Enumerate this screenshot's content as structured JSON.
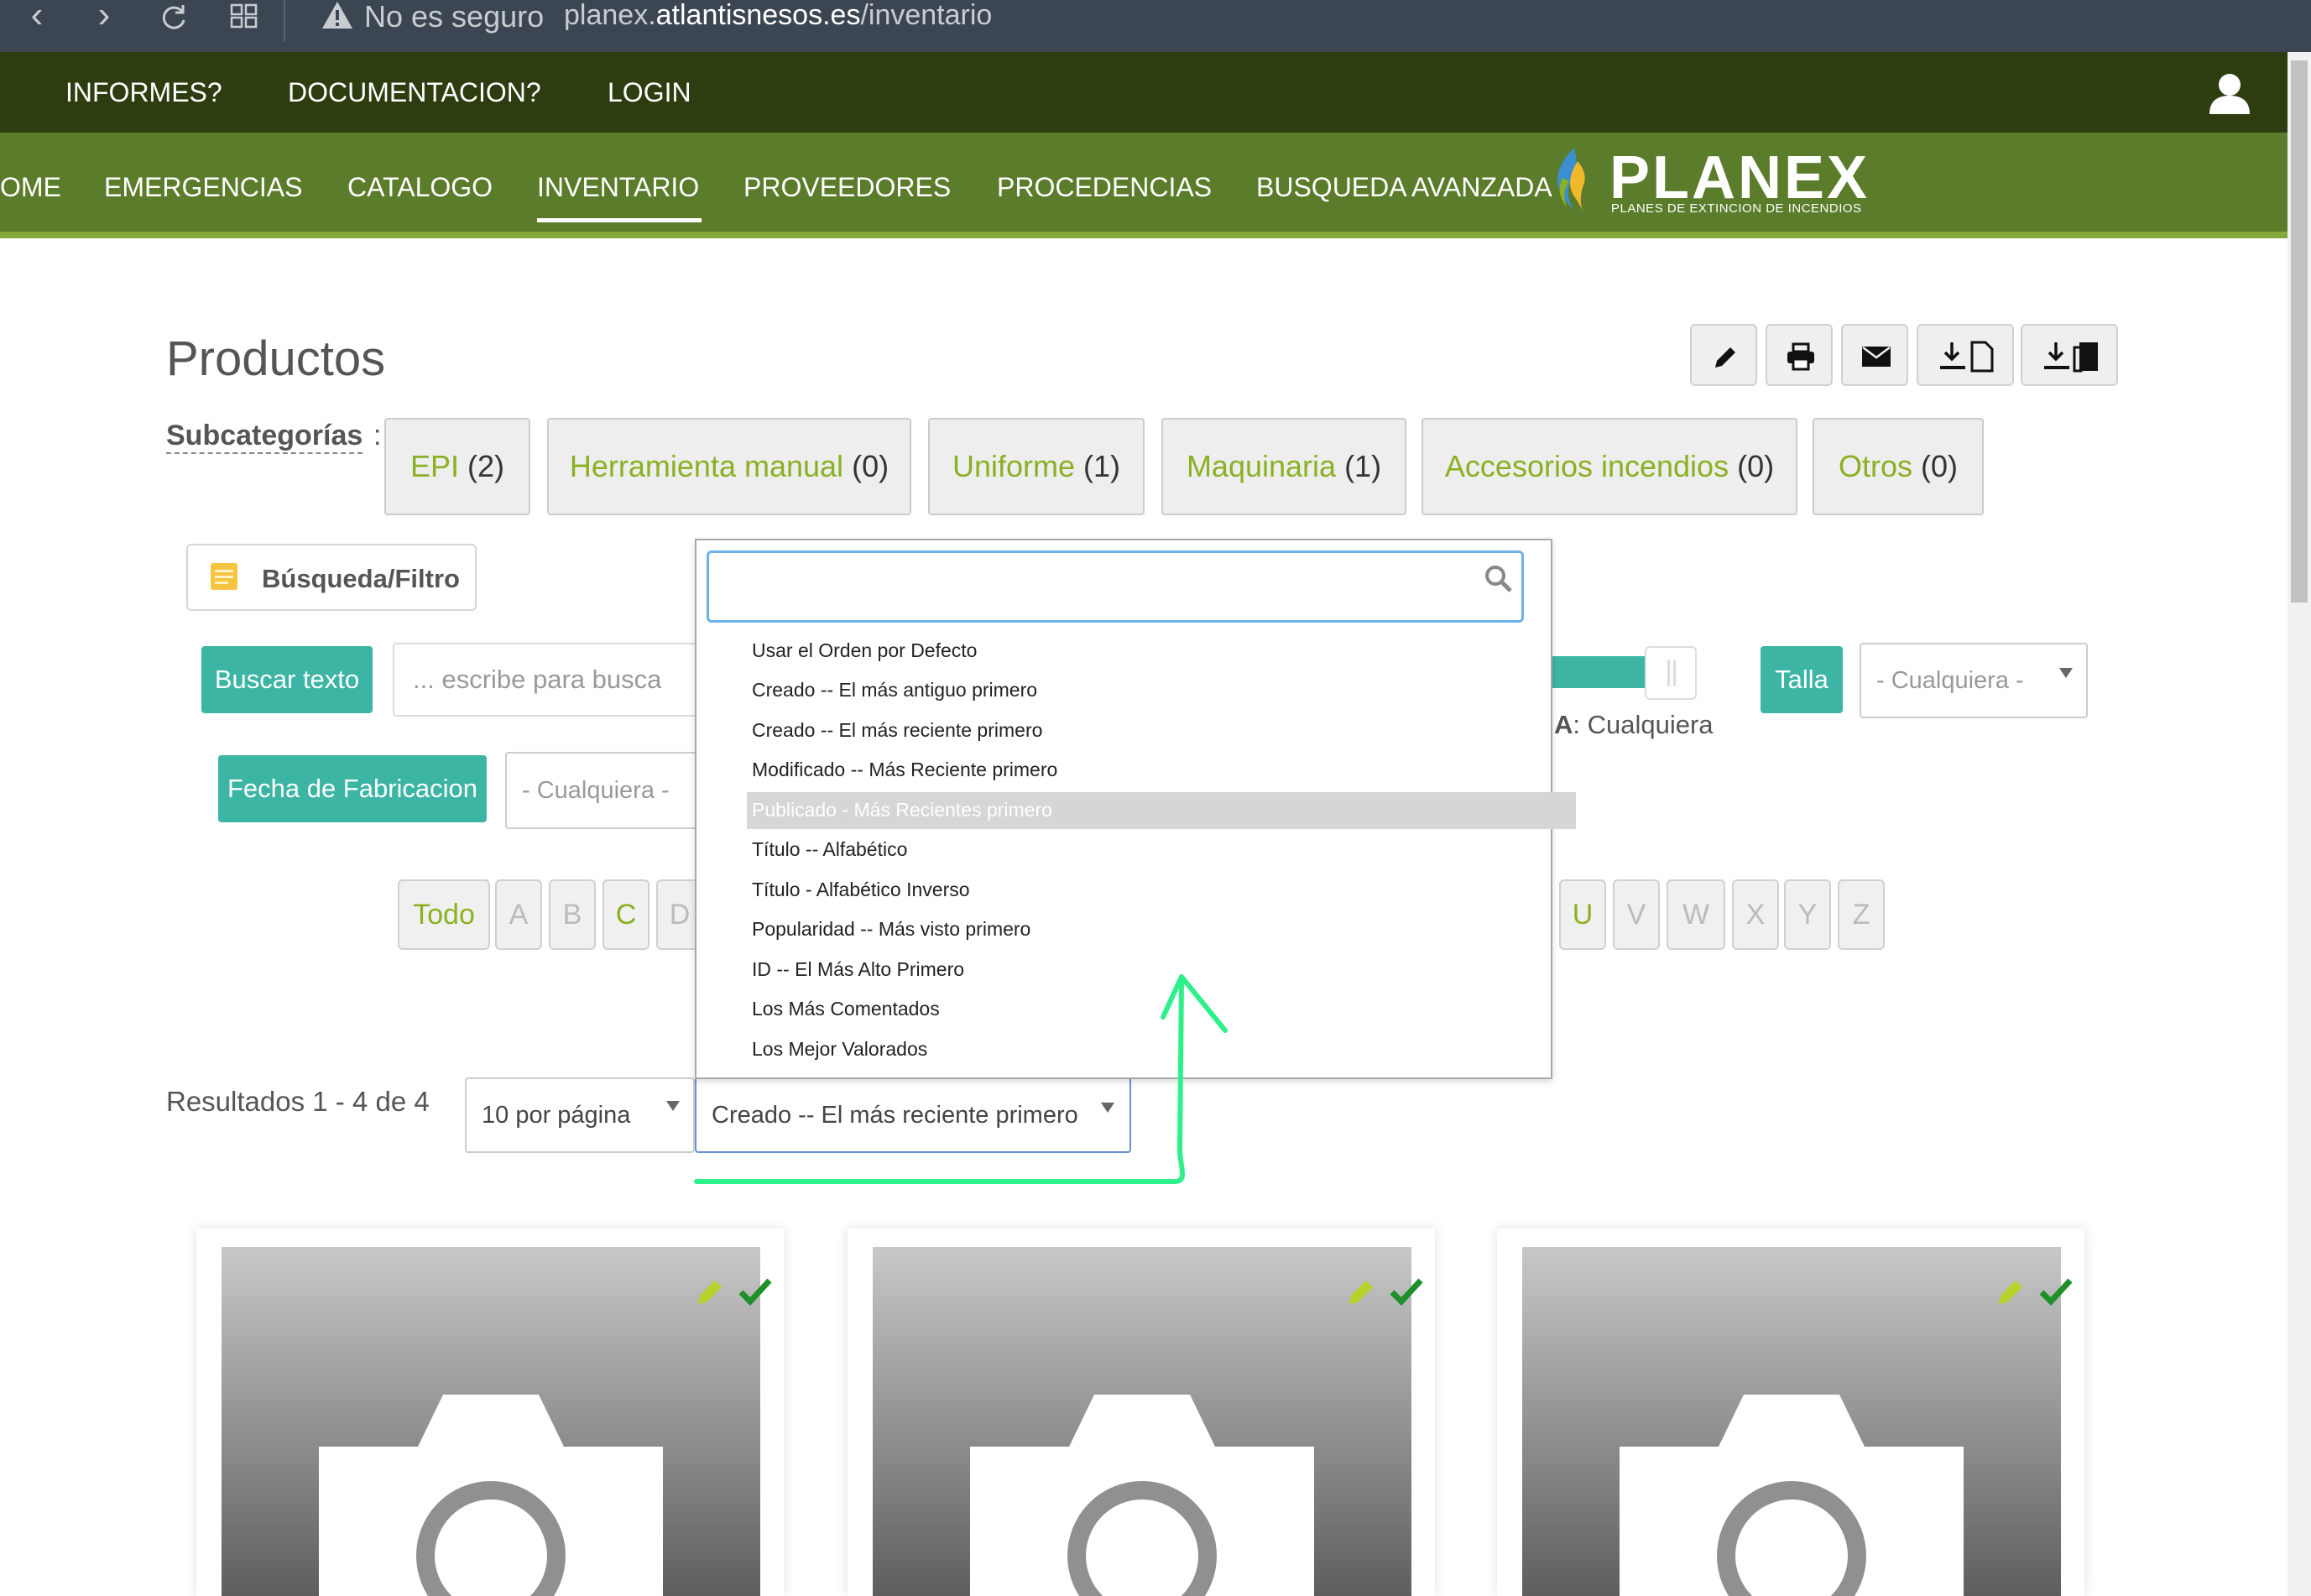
{
  "browser": {
    "warning_text": "No es seguro",
    "url_prefix": "planex.",
    "url_domain": "atlantisnesos.es",
    "url_path": "/inventario"
  },
  "top_nav": {
    "items": [
      "INFORMES?",
      "DOCUMENTACION?",
      "LOGIN"
    ]
  },
  "main_nav": {
    "items": [
      "OME",
      "EMERGENCIAS",
      "CATALOGO",
      "INVENTARIO",
      "PROVEEDORES",
      "PROCEDENCIAS",
      "BUSQUEDA AVANZADA"
    ],
    "active": "INVENTARIO"
  },
  "logo": {
    "name": "PLANEX",
    "subtitle": "PLANES DE EXTINCION DE INCENDIOS"
  },
  "page": {
    "title": "Productos"
  },
  "toolbar": {
    "icons": [
      "pencil-icon",
      "print-icon",
      "mail-icon",
      "download-doc-icon",
      "download-all-icon"
    ]
  },
  "subcategories": {
    "label": "Subcategorías",
    "colon": ":",
    "items": [
      {
        "name": "EPI",
        "count": "(2)"
      },
      {
        "name": "Herramienta manual",
        "count": "(0)"
      },
      {
        "name": "Uniforme",
        "count": "(1)"
      },
      {
        "name": "Maquinaria",
        "count": "(1)"
      },
      {
        "name": "Accesorios incendios",
        "count": "(0)"
      },
      {
        "name": "Otros",
        "count": "(0)"
      }
    ]
  },
  "filters": {
    "toggle_label": "Búsqueda/Filtro",
    "search_button": "Buscar texto",
    "search_placeholder": "... escribe para busca",
    "slider_label_bold": "A",
    "slider_label_value": ": Cualquiera",
    "talla_button": "Talla",
    "talla_value": "- Cualquiera -",
    "fecha_button": "Fecha de Fabricacion",
    "fecha_value": "- Cualquiera -"
  },
  "alphabet": {
    "left": [
      "Todo",
      "A",
      "B",
      "C",
      "D"
    ],
    "right": [
      "U",
      "V",
      "W",
      "X",
      "Y",
      "Z"
    ],
    "active": [
      "Todo",
      "C",
      "U"
    ]
  },
  "results": {
    "text": "Resultados 1 - 4 de 4",
    "per_page": "10 por página",
    "sort_selected": "Creado -- El más reciente primero"
  },
  "sort_dropdown": {
    "search_value": "",
    "options": [
      "Usar el Orden por Defecto",
      "Creado -- El más antiguo primero",
      "Creado -- El más reciente primero",
      "Modificado -- Más Reciente primero",
      "Publicado - Más Recientes primero",
      "Título -- Alfabético",
      "Título - Alfabético Inverso",
      "Popularidad -- Más visto primero",
      "ID -- El Más Alto Primero",
      "Los Más Comentados",
      "Los Mejor Valorados"
    ],
    "highlighted": "Publicado - Más Recientes primero"
  },
  "colors": {
    "top_nav_bg": "#2e3d10",
    "main_nav_bg": "#5b7c2a",
    "accent_green": "#8bb021",
    "teal": "#3cb5a5",
    "annotation": "#2ef08a"
  }
}
